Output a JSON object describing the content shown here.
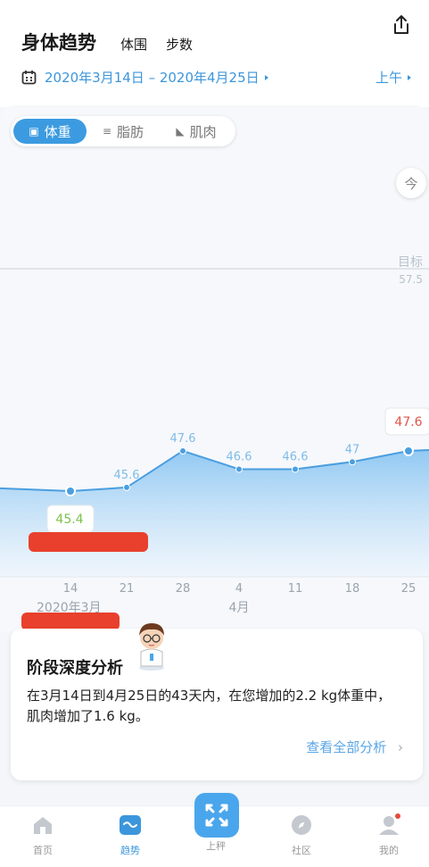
{
  "header": {
    "main_tab": "身体趋势",
    "sub_tabs": [
      "体围",
      "步数"
    ],
    "share_icon": "share-icon"
  },
  "date_range": {
    "label": "2020年3月14日 – 2020年4月25日",
    "period": "上午"
  },
  "metric_tabs": [
    {
      "label": "体重",
      "active": true,
      "icon": "scale-icon"
    },
    {
      "label": "脂肪",
      "active": false,
      "icon": "fat-icon"
    },
    {
      "label": "肌肉",
      "active": false,
      "icon": "muscle-icon"
    }
  ],
  "today_button": "今",
  "chart_data": {
    "type": "area",
    "x": [
      "14",
      "21",
      "28",
      "4",
      "11",
      "18",
      "25"
    ],
    "values": [
      45.4,
      45.6,
      47.6,
      46.6,
      46.6,
      47.0,
      47.6
    ],
    "month_labels": [
      "2020年3月",
      "4月"
    ],
    "goal_label": "目标",
    "goal_value": 57.5,
    "highlight_first": "45.4",
    "highlight_last": "47.6",
    "colors": {
      "line": "#4a9ee0",
      "first_label": "#7cc24a",
      "last_label": "#e0564a",
      "goal": "#c8d2da"
    }
  },
  "analysis": {
    "title": "阶段深度分析",
    "text": "在3月14日到4月25日的43天内，在您增加的2.2 kg体重中，肌肉增加了1.6 kg。",
    "link": "查看全部分析"
  },
  "tabbar": {
    "items": [
      {
        "label": "首页",
        "icon": "home-icon",
        "active": false
      },
      {
        "label": "趋势",
        "icon": "trend-icon",
        "active": true
      },
      {
        "label": "上秤",
        "icon": "scale-weigh-icon",
        "active": false
      },
      {
        "label": "社区",
        "icon": "compass-icon",
        "active": false
      },
      {
        "label": "我的",
        "icon": "profile-icon",
        "active": false
      }
    ]
  },
  "accent": "#3c96dc"
}
